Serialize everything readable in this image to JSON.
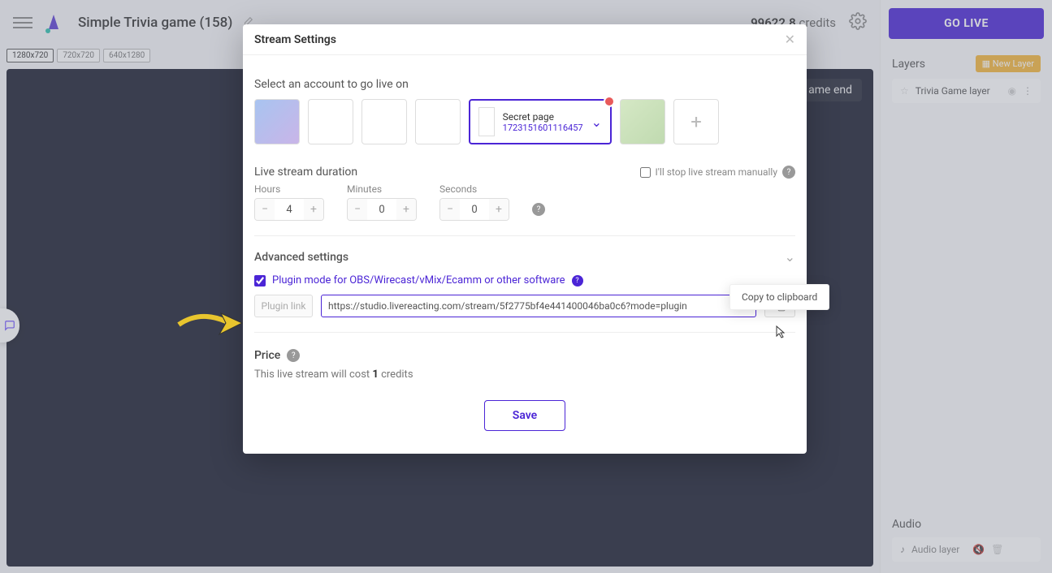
{
  "header": {
    "title": "Simple Trivia game (158)",
    "credits_value": "99622.8",
    "credits_label": "credits"
  },
  "resolutions": [
    "1280x720",
    "720x720",
    "640x1280"
  ],
  "canvas_chip": "ame end",
  "golive": "GO LIVE",
  "layers": {
    "title": "Layers",
    "new_btn": "New Layer",
    "item": "Trivia Game layer"
  },
  "audio": {
    "title": "Audio",
    "item": "Audio layer"
  },
  "modal": {
    "title": "Stream Settings",
    "select_label": "Select an account to go live on",
    "selected_account": {
      "name": "Secret page",
      "id": "1723151601116457"
    },
    "duration": {
      "title": "Live stream duration",
      "manual": "I'll stop live stream manually",
      "hours_label": "Hours",
      "hours_val": "4",
      "minutes_label": "Minutes",
      "minutes_val": "0",
      "seconds_label": "Seconds",
      "seconds_val": "0"
    },
    "advanced": {
      "title": "Advanced settings",
      "plugin_label": "Plugin mode for OBS/Wirecast/vMix/Ecamm or other software",
      "link_label": "Plugin link",
      "link_value": "https://studio.livereacting.com/stream/5f2775bf4e441400046ba0c6?mode=plugin",
      "tooltip": "Copy to clipboard"
    },
    "price": {
      "title": "Price",
      "text_pre": "This live stream will cost ",
      "cost": "1",
      "text_post": " credits"
    },
    "save": "Save"
  }
}
